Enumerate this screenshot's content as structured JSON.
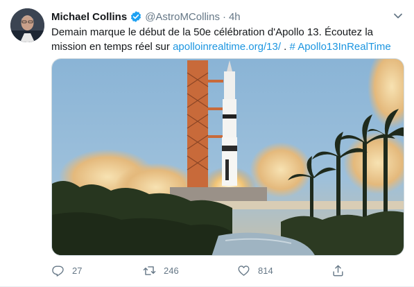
{
  "tweet": {
    "author_name": "Michael Collins",
    "handle": "@AstroMCollins",
    "separator": "·",
    "time": "4h",
    "text_before_link": "Demain marque le début de la 50e célébration d'Apollo 13. Écoutez la mission en temps réel sur ",
    "link": "apolloinrealtime.org/13/",
    "text_between": " . ",
    "hashtag": "# Apollo13InRealTime",
    "icons": {
      "verified": "verified-badge-icon",
      "more": "chevron-down-icon"
    },
    "colors": {
      "link": "#1b95e0",
      "muted": "#657786",
      "verified": "#1da1f2"
    }
  },
  "actions": {
    "reply_count": "27",
    "retweet_count": "246",
    "like_count": "814",
    "icons": [
      "reply-icon",
      "retweet-icon",
      "like-icon",
      "share-icon"
    ]
  }
}
